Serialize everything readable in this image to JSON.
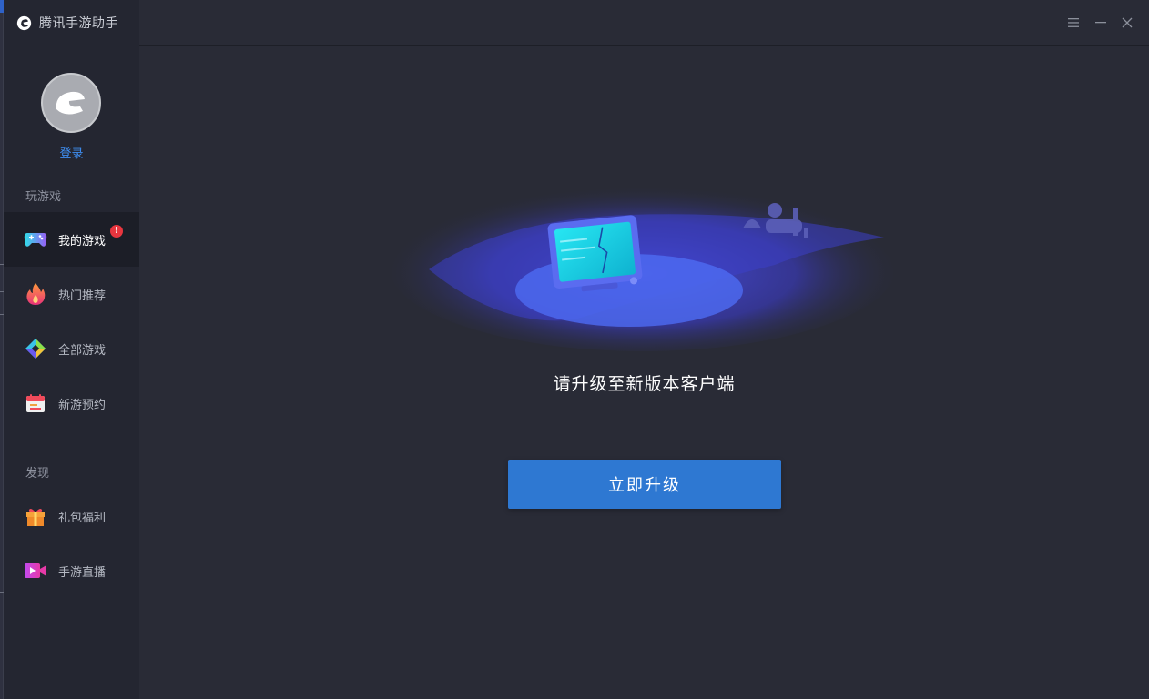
{
  "app": {
    "title": "腾讯手游助手"
  },
  "user": {
    "login_label": "登录"
  },
  "sidebar": {
    "section_play": "玩游戏",
    "section_discover": "发现",
    "items": [
      {
        "label": "我的游戏",
        "icon": "gamepad-icon",
        "active": true,
        "badge": "!"
      },
      {
        "label": "热门推荐",
        "icon": "flame-icon"
      },
      {
        "label": "全部游戏",
        "icon": "cube-icon"
      },
      {
        "label": "新游预约",
        "icon": "calendar-icon"
      },
      {
        "label": "礼包福利",
        "icon": "gift-icon"
      },
      {
        "label": "手游直播",
        "icon": "live-video-icon"
      }
    ]
  },
  "window_controls": [
    "menu-icon",
    "minimize-icon",
    "close-icon"
  ],
  "main": {
    "message": "请升级至新版本客户端",
    "upgrade_button": "立即升级"
  },
  "colors": {
    "background": "#292b36",
    "sidebar": "#242631",
    "accent": "#2e78d2",
    "link": "#3e8df0",
    "badge": "#e8363f"
  }
}
